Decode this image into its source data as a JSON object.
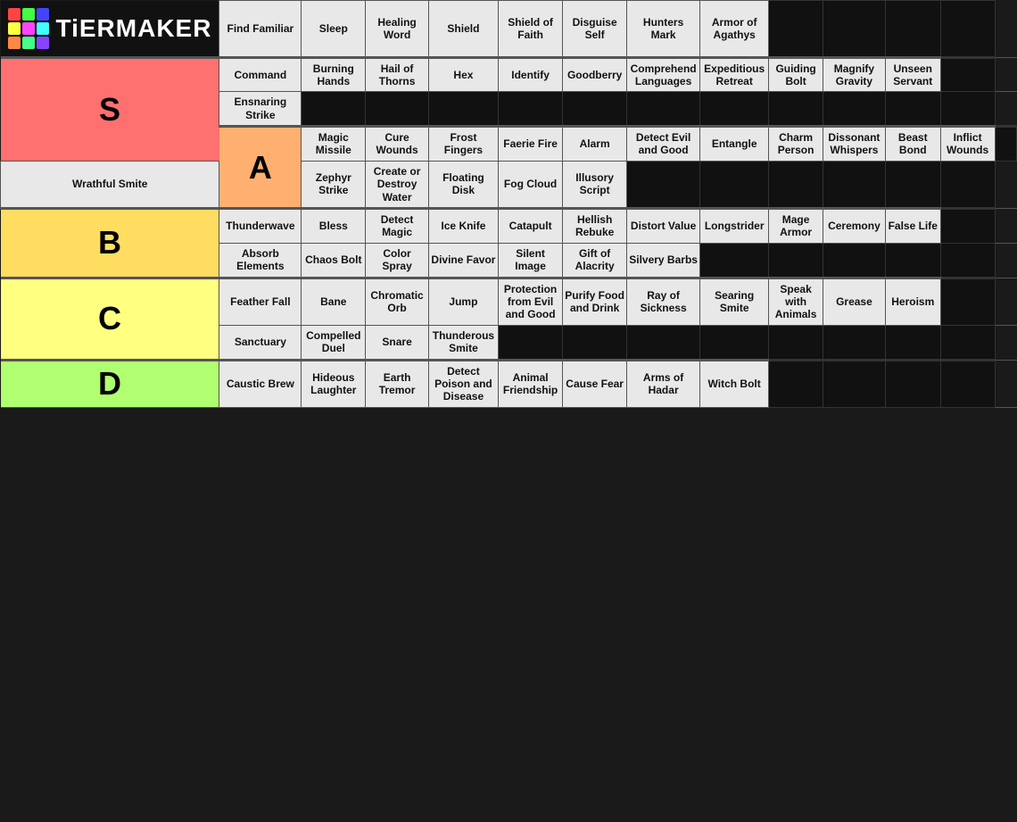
{
  "logo": {
    "text": "TiERMAKER",
    "dots": [
      "#ff4444",
      "#44ff44",
      "#4444ff",
      "#ffff44",
      "#ff44ff",
      "#44ffff",
      "#ff8844",
      "#44ff88",
      "#8844ff"
    ]
  },
  "tiers": {
    "S": {
      "label": "S",
      "color": "tier-s",
      "rows": [
        [
          "Find Familiar",
          "Sleep",
          "Healing Word",
          "Shield",
          "Shield of Faith",
          "Disguise Self",
          "Hunters Mark",
          "Armor of Agathys",
          "",
          "",
          "",
          ""
        ],
        [
          "Command",
          "Burning Hands",
          "Hail of Thorns",
          "Hex",
          "Identify",
          "Goodberry",
          "Comprehend Languages",
          "Expeditious Retreat",
          "Guiding Bolt",
          "Magnify Gravity",
          "Unseen Servant",
          ""
        ],
        [
          "Ensnaring Strike",
          "",
          "",
          "",
          "",
          "",
          "",
          "",
          "",
          "",
          "",
          ""
        ]
      ]
    },
    "A": {
      "label": "A",
      "color": "tier-a",
      "rows": [
        [
          "Magic Missile",
          "Cure Wounds",
          "Frost Fingers",
          "Faerie Fire",
          "Alarm",
          "Detect Evil and Good",
          "Entangle",
          "Charm Person",
          "Dissonant Whispers",
          "Beast Bond",
          "Inflict Wounds",
          ""
        ],
        [
          "Wrathful Smite",
          "Zephyr Strike",
          "Create or Destroy Water",
          "Floating Disk",
          "Fog Cloud",
          "Illusory Script",
          "",
          "",
          "",
          "",
          "",
          ""
        ]
      ]
    },
    "B": {
      "label": "B",
      "color": "tier-b",
      "rows": [
        [
          "Thunderwave",
          "Bless",
          "Detect Magic",
          "Ice Knife",
          "Catapult",
          "Hellish Rebuke",
          "Distort Value",
          "Longstrider",
          "Mage Armor",
          "Ceremony",
          "False Life",
          ""
        ],
        [
          "Absorb Elements",
          "Chaos Bolt",
          "Color Spray",
          "Divine Favor",
          "Silent Image",
          "Gift of Alacrity",
          "Silvery Barbs",
          "",
          "",
          "",
          "",
          ""
        ]
      ]
    },
    "C": {
      "label": "C",
      "color": "tier-c",
      "rows": [
        [
          "Feather Fall",
          "Bane",
          "Chromatic Orb",
          "Jump",
          "Protection from Evil and Good",
          "Purify Food and Drink",
          "Ray of Sickness",
          "Searing Smite",
          "Speak with Animals",
          "Grease",
          "Heroism",
          ""
        ],
        [
          "Sanctuary",
          "Compelled Duel",
          "Snare",
          "Thunderous Smite",
          "",
          "",
          "",
          "",
          "",
          "",
          "",
          ""
        ]
      ]
    },
    "D": {
      "label": "D",
      "color": "tier-d",
      "rows": [
        [
          "Caustic Brew",
          "Hideous Laughter",
          "Earth Tremor",
          "Detect Poison and Disease",
          "Animal Friendship",
          "Cause Fear",
          "Arms of Hadar",
          "Witch Bolt",
          "",
          "",
          "",
          ""
        ]
      ]
    }
  }
}
